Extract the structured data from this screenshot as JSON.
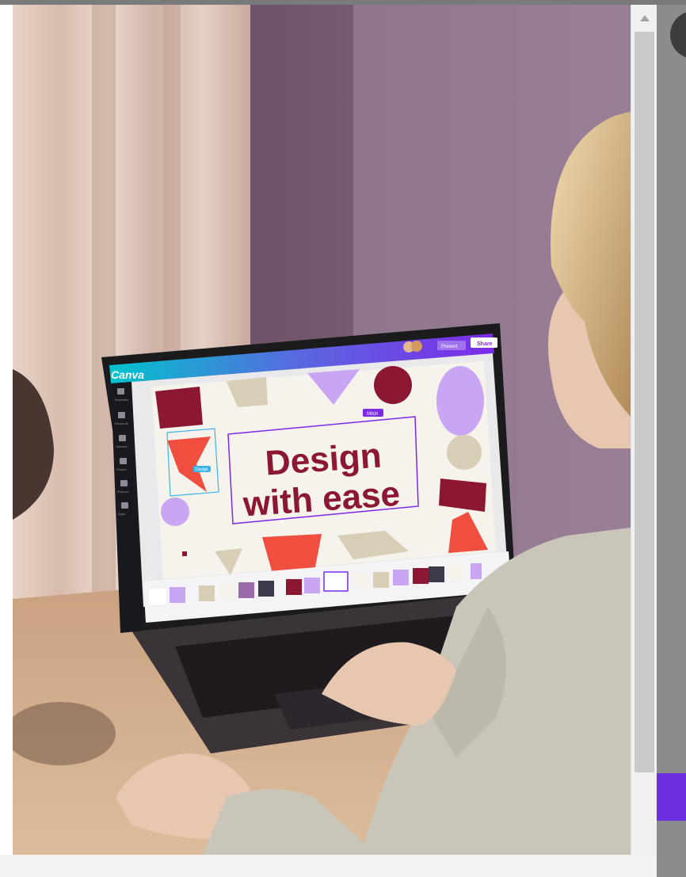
{
  "screen": {
    "logo": "Canva",
    "share_label": "Share",
    "present_label": "Present",
    "selection_tag": "Mitch",
    "small_tag": "Design",
    "headline_line1": "Design",
    "headline_line2": "with ease",
    "sidebar_items": [
      "Templates",
      "Elements",
      "Uploads",
      "Photos",
      "Projects",
      "Apps"
    ]
  },
  "colors": {
    "accent": "#7d2ae8",
    "brand_teal": "#00c4cc",
    "headline": "#8b1732",
    "wall": "#6e5468"
  },
  "icons": {
    "scroll_up": "triangle-up",
    "scroll_down": "triangle-down"
  }
}
